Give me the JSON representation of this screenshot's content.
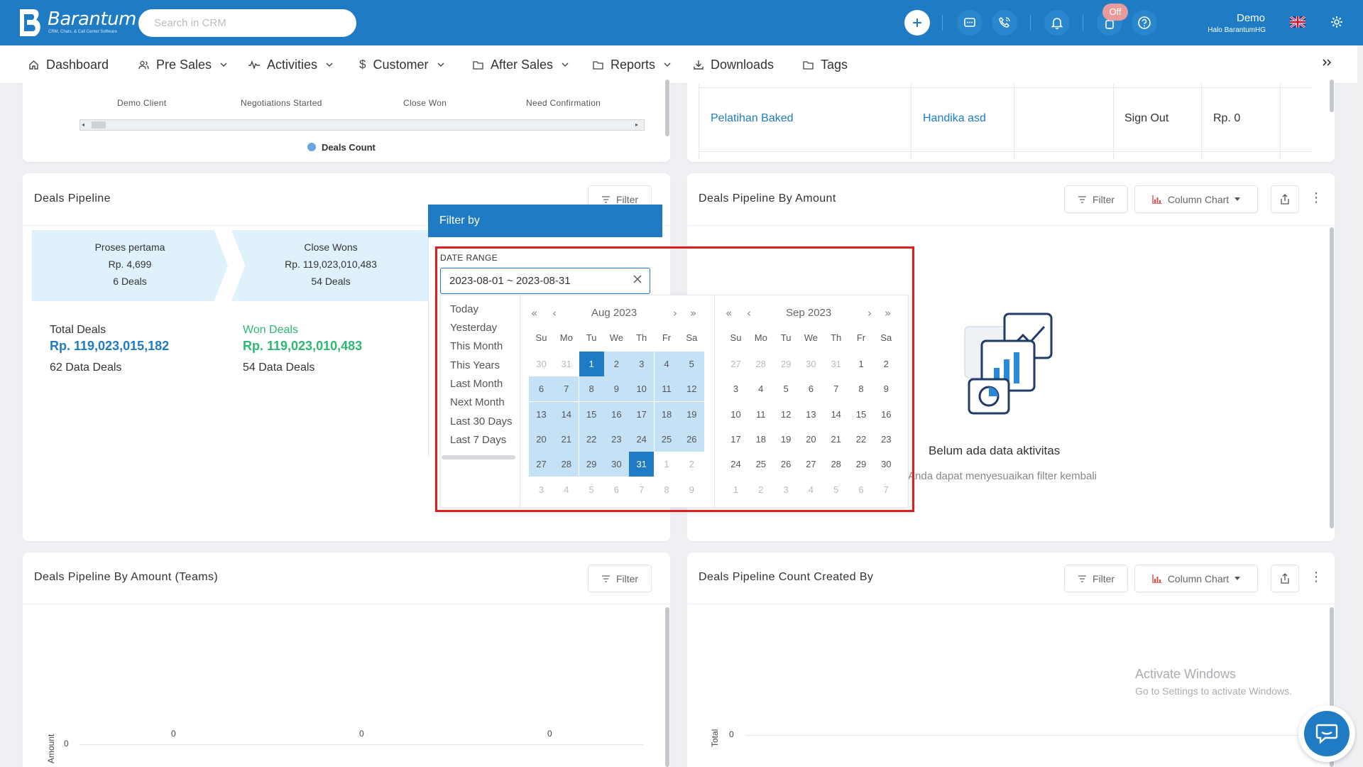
{
  "app": {
    "logo_text": "Barantum",
    "logo_sub": "CRM, Chats, & Call Center Software",
    "search_placeholder": "Search in CRM",
    "off_badge": "Off",
    "user_name": "Demo",
    "user_sub": "Halo BarantumHG"
  },
  "nav": [
    {
      "label": "Dashboard"
    },
    {
      "label": "Pre Sales"
    },
    {
      "label": "Activities"
    },
    {
      "label": "Customer"
    },
    {
      "label": "After Sales"
    },
    {
      "label": "Reports"
    },
    {
      "label": "Downloads"
    },
    {
      "label": "Tags"
    }
  ],
  "top_left": {
    "categories": [
      "Demo Client",
      "Negotiations Started",
      "Close Won",
      "Need Confirmation"
    ],
    "legend": "Deals Count"
  },
  "top_right": {
    "row": [
      "Pelatihan Baked",
      "Handika asd",
      "",
      "Sign Out",
      "Rp. 0"
    ]
  },
  "deals_pipeline": {
    "title": "Deals Pipeline",
    "filter": "Filter",
    "stages": [
      {
        "name": "Proses pertama",
        "amount": "Rp. 4,699",
        "deals": "6 Deals"
      },
      {
        "name": "Close Wons",
        "amount": "Rp. 119,023,010,483",
        "deals": "54 Deals"
      }
    ],
    "total_label": "Total Deals",
    "total_value": "Rp. 119,023,015,182",
    "total_sub": "62 Data Deals",
    "won_label": "Won Deals",
    "won_value": "Rp. 119,023,010,483",
    "won_sub": "54 Data Deals"
  },
  "filter_popup": {
    "title": "Filter by",
    "date_range_label": "DATE RANGE",
    "date_range_value": "2023-08-01 ~ 2023-08-31",
    "presets": [
      "Today",
      "Yesterday",
      "This Month",
      "This Years",
      "Last Month",
      "Next Month",
      "Last 30 Days",
      "Last 7 Days"
    ],
    "dow": [
      "Su",
      "Mo",
      "Tu",
      "We",
      "Th",
      "Fr",
      "Sa"
    ],
    "left_month": {
      "title": "Aug  2023",
      "days": [
        "30",
        "31",
        "1",
        "2",
        "3",
        "4",
        "5",
        "6",
        "7",
        "8",
        "9",
        "10",
        "11",
        "12",
        "13",
        "14",
        "15",
        "16",
        "17",
        "18",
        "19",
        "20",
        "21",
        "22",
        "23",
        "24",
        "25",
        "26",
        "27",
        "28",
        "29",
        "30",
        "31",
        "1",
        "2",
        "3",
        "4",
        "5",
        "6",
        "7",
        "8",
        "9"
      ]
    },
    "right_month": {
      "title": "Sep  2023",
      "days": [
        "27",
        "28",
        "29",
        "30",
        "31",
        "1",
        "2",
        "3",
        "4",
        "5",
        "6",
        "7",
        "8",
        "9",
        "10",
        "11",
        "12",
        "13",
        "14",
        "15",
        "16",
        "17",
        "18",
        "19",
        "20",
        "21",
        "22",
        "23",
        "24",
        "25",
        "26",
        "27",
        "28",
        "29",
        "30",
        "1",
        "2",
        "3",
        "4",
        "5",
        "6",
        "7"
      ]
    }
  },
  "by_amount": {
    "title": "Deals Pipeline By Amount",
    "filter": "Filter",
    "chart_type": "Column Chart",
    "empty_title": "Belum ada data aktivitas",
    "empty_sub": "Anda dapat menyesuaikan filter kembali"
  },
  "by_amount_teams": {
    "title": "Deals Pipeline By Amount (Teams)",
    "filter": "Filter",
    "ylabel": "Amount",
    "y_tick": "0",
    "value_labels": [
      "0",
      "0",
      "0"
    ]
  },
  "count_created_by": {
    "title": "Deals Pipeline Count Created By",
    "filter": "Filter",
    "chart_type": "Column Chart",
    "ylabel": "Total",
    "y_tick": "0"
  },
  "watermark": {
    "line1": "Activate Windows",
    "line2": "Go to Settings to activate Windows."
  }
}
